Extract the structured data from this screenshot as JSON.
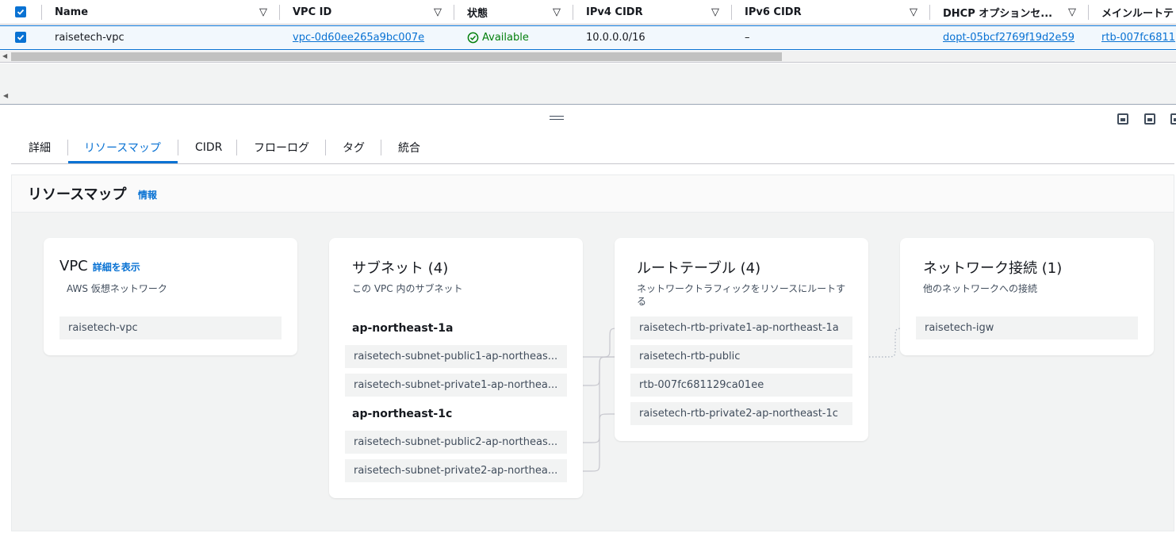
{
  "table": {
    "headers": {
      "name": "Name",
      "vpc_id": "VPC ID",
      "state": "状態",
      "ipv4": "IPv4 CIDR",
      "ipv6": "IPv6 CIDR",
      "dhcp": "DHCP オプションセ...",
      "main_rt": "メインルートテ"
    },
    "row": {
      "name": "raisetech-vpc",
      "vpc_id": "vpc-0d60ee265a9bc007e",
      "state": "Available",
      "ipv4": "10.0.0.0/16",
      "ipv6": "–",
      "dhcp": "dopt-05bcf2769f19d2e59",
      "main_rt": "rtb-007fc6811"
    }
  },
  "tabs": [
    "詳細",
    "リソースマップ",
    "CIDR",
    "フローログ",
    "タグ",
    "統合"
  ],
  "resource_map": {
    "title": "リソースマップ",
    "info": "情報",
    "vpc": {
      "title": "VPC",
      "link": "詳細を表示",
      "subtitle": "AWS 仮想ネットワーク",
      "items": [
        "raisetech-vpc"
      ]
    },
    "subnets": {
      "title": "サブネット (4)",
      "subtitle": "この VPC 内のサブネット",
      "groups": [
        {
          "az": "ap-northeast-1a",
          "items": [
            "raisetech-subnet-public1-ap-northeas...",
            "raisetech-subnet-private1-ap-northea..."
          ]
        },
        {
          "az": "ap-northeast-1c",
          "items": [
            "raisetech-subnet-public2-ap-northeas...",
            "raisetech-subnet-private2-ap-northea..."
          ]
        }
      ]
    },
    "route_tables": {
      "title": "ルートテーブル (4)",
      "subtitle": "ネットワークトラフィックをリソースにルートする",
      "items": [
        "raisetech-rtb-private1-ap-northeast-1a",
        "raisetech-rtb-public",
        "rtb-007fc681129ca01ee",
        "raisetech-rtb-private2-ap-northeast-1c"
      ]
    },
    "connections": {
      "title": "ネットワーク接続 (1)",
      "subtitle": "他のネットワークへの接続",
      "items": [
        "raisetech-igw"
      ]
    }
  },
  "colors": {
    "accent": "#0972d3",
    "success": "#037f0c",
    "line": "#9ba7b6"
  }
}
